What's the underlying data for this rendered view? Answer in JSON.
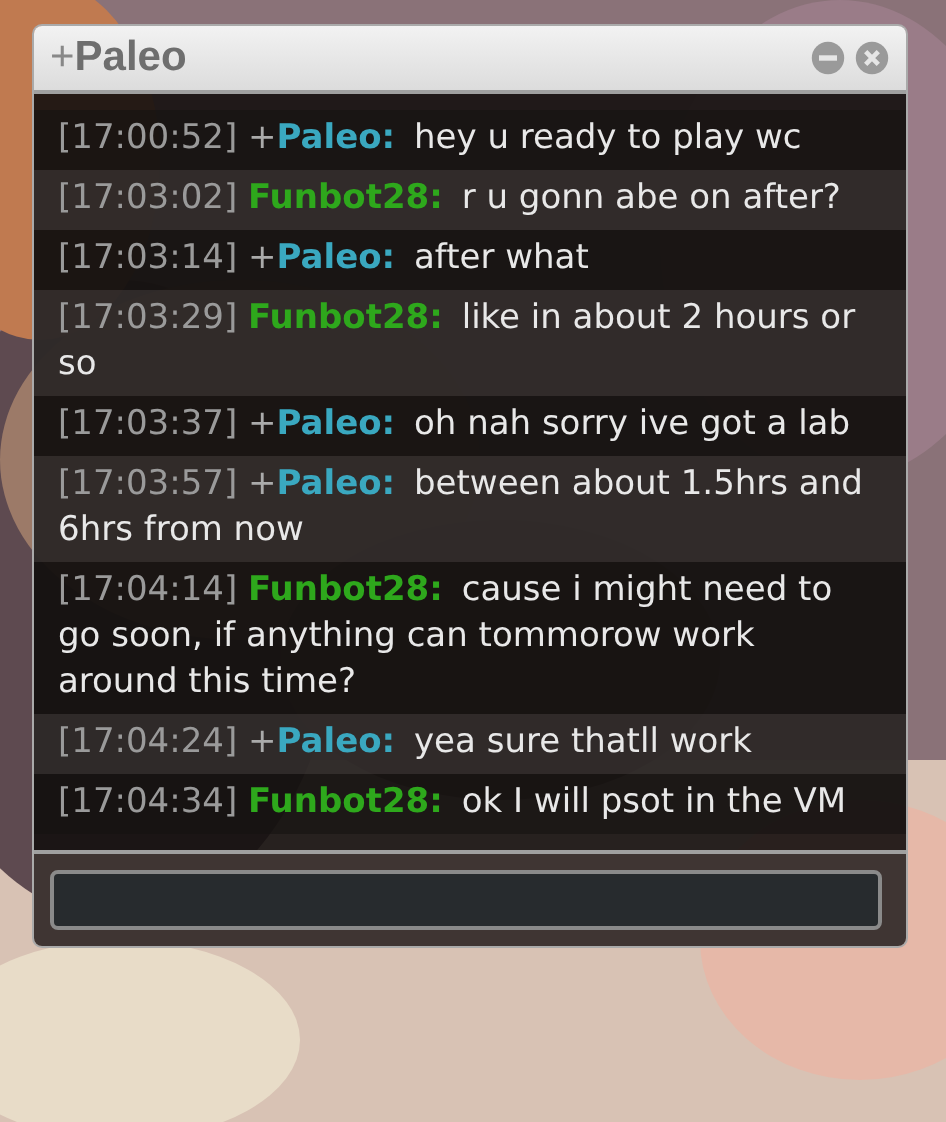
{
  "window": {
    "title_rank": "+",
    "title": "Paleo"
  },
  "messages": [
    {
      "time": "[17:00:52]",
      "rank": "+",
      "name": "Paleo:",
      "color": "#3aa8c0",
      "text": "hey u ready to play wc"
    },
    {
      "time": "[17:03:02]",
      "name": "Funbot28:",
      "color": "#2ea81c",
      "text": "r u gonn abe on after?"
    },
    {
      "time": "[17:03:14]",
      "rank": "+",
      "name": "Paleo:",
      "color": "#3aa8c0",
      "text": "after what"
    },
    {
      "time": "[17:03:29]",
      "name": "Funbot28:",
      "color": "#2ea81c",
      "text": "like in about 2 hours or so"
    },
    {
      "time": "[17:03:37]",
      "rank": "+",
      "name": "Paleo:",
      "color": "#3aa8c0",
      "text": "oh nah sorry ive got a lab"
    },
    {
      "time": "[17:03:57]",
      "rank": "+",
      "name": "Paleo:",
      "color": "#3aa8c0",
      "text": "between about 1.5hrs and 6hrs from now"
    },
    {
      "time": "[17:04:14]",
      "name": "Funbot28:",
      "color": "#2ea81c",
      "text": "cause i might need to go soon, if anything can tommorow work around this time?"
    },
    {
      "time": "[17:04:24]",
      "rank": "+",
      "name": "Paleo:",
      "color": "#3aa8c0",
      "text": "yea sure thatll work"
    },
    {
      "time": "[17:04:34]",
      "name": "Funbot28:",
      "color": "#2ea81c",
      "text": "ok I will psot in the VM"
    }
  ]
}
